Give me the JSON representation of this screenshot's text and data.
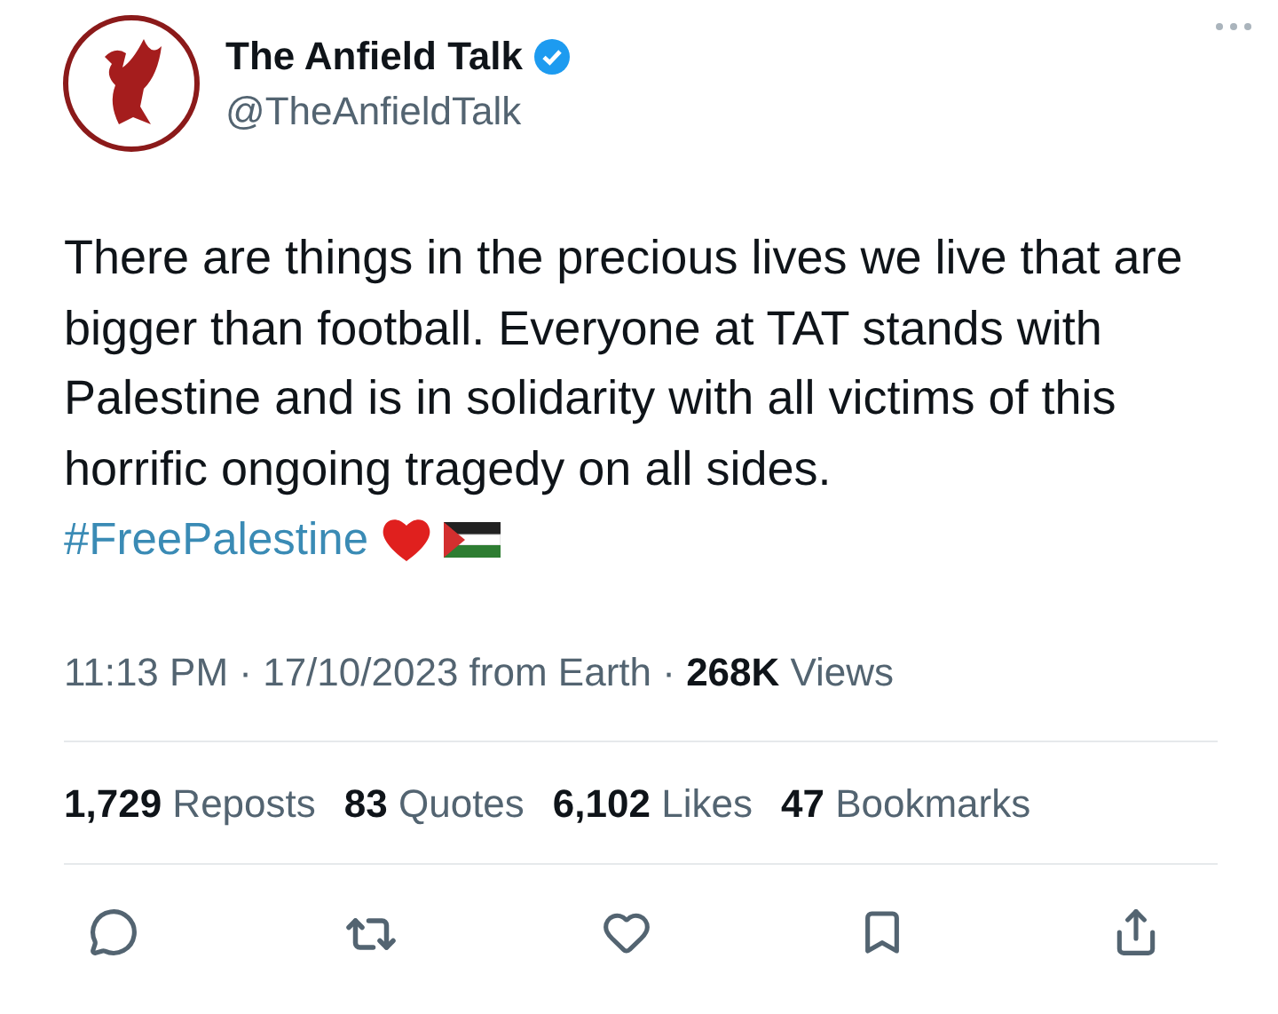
{
  "author": {
    "name": "The Anfield Talk",
    "verified": true,
    "handle": "@TheAnfieldTalk"
  },
  "tweet": {
    "text": "There are things in the precious lives we live that are bigger than football. Everyone at TAT stands with Palestine and is in solidarity with all victims of this horrific ongoing tragedy on all sides.",
    "hashtag": "#FreePalestine"
  },
  "meta": "11:13 PM · 17/10/2023 from Earth · **268K** Views",
  "stats": [
    {
      "text": "**1,729** Reposts"
    },
    {
      "text": "**83** Quotes"
    },
    {
      "text": "**6,102** Likes"
    },
    {
      "text": "**47** Bookmarks"
    }
  ]
}
